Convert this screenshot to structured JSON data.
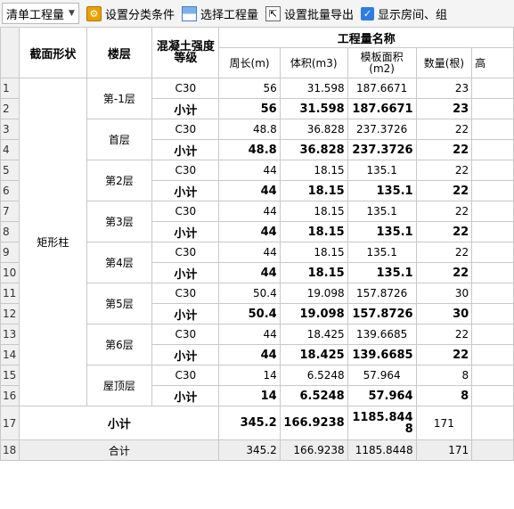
{
  "toolbar": {
    "select_value": "清单工程量",
    "btn_conditions": "设置分类条件",
    "btn_select_qty": "选择工程量",
    "btn_batch_export": "设置批量导出",
    "chk_show_room": "显示房间、组"
  },
  "table": {
    "group_header": "工程量名称",
    "headers": {
      "section": "截面形状",
      "floor": "楼层",
      "concrete": "混凝土强度等级",
      "perimeter": "周长(m)",
      "volume": "体积(m3)",
      "formwork": "模板面积(m2)",
      "count": "数量(根)",
      "height": "高"
    },
    "section_shape": "矩形柱",
    "subtotal_label": "小计",
    "floors": [
      {
        "name": "第-1层",
        "grade": "C30",
        "perimeter": "56",
        "volume": "31.598",
        "formwork": "187.6671",
        "count": "23",
        "sub_perimeter": "56",
        "sub_volume": "31.598",
        "sub_formwork": "187.6671",
        "sub_count": "23"
      },
      {
        "name": "首层",
        "grade": "C30",
        "perimeter": "48.8",
        "volume": "36.828",
        "formwork": "237.3726",
        "count": "22",
        "sub_perimeter": "48.8",
        "sub_volume": "36.828",
        "sub_formwork": "237.3726",
        "sub_count": "22"
      },
      {
        "name": "第2层",
        "grade": "C30",
        "perimeter": "44",
        "volume": "18.15",
        "formwork": "135.1",
        "count": "22",
        "sub_perimeter": "44",
        "sub_volume": "18.15",
        "sub_formwork": "135.1",
        "sub_count": "22"
      },
      {
        "name": "第3层",
        "grade": "C30",
        "perimeter": "44",
        "volume": "18.15",
        "formwork": "135.1",
        "count": "22",
        "sub_perimeter": "44",
        "sub_volume": "18.15",
        "sub_formwork": "135.1",
        "sub_count": "22"
      },
      {
        "name": "第4层",
        "grade": "C30",
        "perimeter": "44",
        "volume": "18.15",
        "formwork": "135.1",
        "count": "22",
        "sub_perimeter": "44",
        "sub_volume": "18.15",
        "sub_formwork": "135.1",
        "sub_count": "22"
      },
      {
        "name": "第5层",
        "grade": "C30",
        "perimeter": "50.4",
        "volume": "19.098",
        "formwork": "157.8726",
        "count": "30",
        "sub_perimeter": "50.4",
        "sub_volume": "19.098",
        "sub_formwork": "157.8726",
        "sub_count": "30"
      },
      {
        "name": "第6层",
        "grade": "C30",
        "perimeter": "44",
        "volume": "18.425",
        "formwork": "139.6685",
        "count": "22",
        "sub_perimeter": "44",
        "sub_volume": "18.425",
        "sub_formwork": "139.6685",
        "sub_count": "22"
      },
      {
        "name": "屋顶层",
        "grade": "C30",
        "perimeter": "14",
        "volume": "6.5248",
        "formwork": "57.964",
        "count": "8",
        "sub_perimeter": "14",
        "sub_volume": "6.5248",
        "sub_formwork": "57.964",
        "sub_count": "8"
      }
    ],
    "section_subtotal": {
      "label": "小计",
      "perimeter": "345.2",
      "volume": "166.9238",
      "formwork": "1185.8448",
      "count": "171"
    },
    "grand_total": {
      "label": "合计",
      "perimeter": "345.2",
      "volume": "166.9238",
      "formwork": "1185.8448",
      "count": "171"
    },
    "row_numbers": [
      "1",
      "2",
      "3",
      "4",
      "5",
      "6",
      "7",
      "8",
      "9",
      "10",
      "11",
      "12",
      "13",
      "14",
      "15",
      "16",
      "17",
      "18"
    ]
  }
}
